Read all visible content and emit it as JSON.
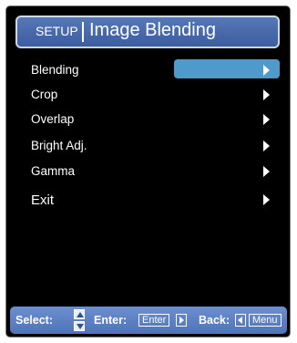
{
  "header": {
    "setup_label": "SETUP",
    "title": "Image Blending"
  },
  "menu": {
    "items": [
      {
        "label": "Blending",
        "selected": true
      },
      {
        "label": "Crop"
      },
      {
        "label": "Overlap"
      },
      {
        "label": "Bright Adj."
      },
      {
        "label": "Gamma"
      },
      {
        "label": "Exit"
      }
    ]
  },
  "footer": {
    "select_label": "Select:",
    "enter_label": "Enter:",
    "enter_key": "Enter",
    "back_label": "Back:",
    "menu_key": "Menu"
  },
  "colors": {
    "header_bg": "#4a6db0",
    "highlight": "#4f9ac9",
    "footer_bg": "#5c80c3",
    "panel_bg": "#000000"
  }
}
